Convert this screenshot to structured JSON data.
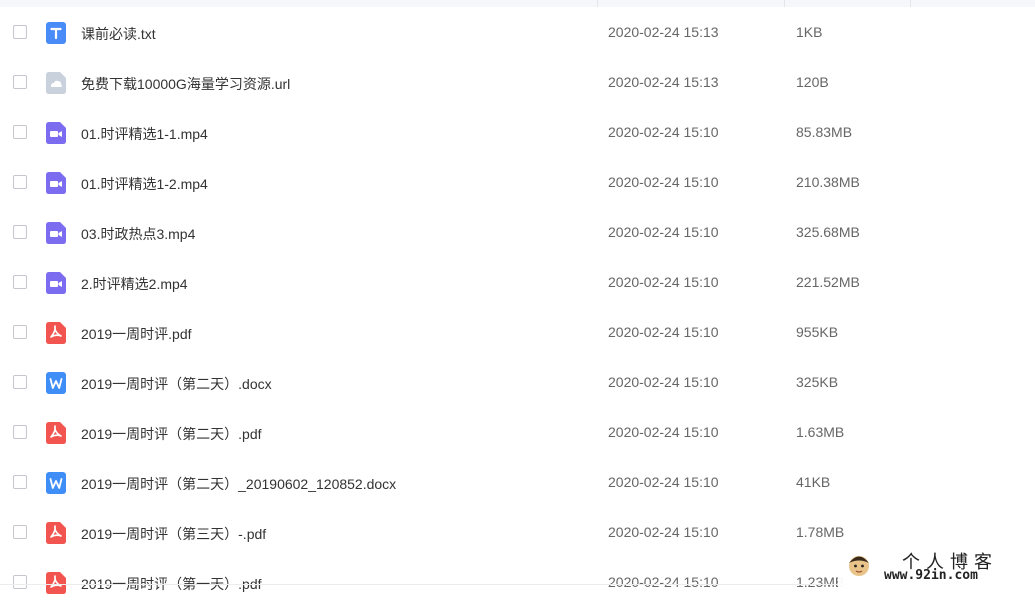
{
  "files": [
    {
      "name": "课前必读.txt",
      "date": "2020-02-24 15:13",
      "size": "1KB",
      "icon": "txt-file-icon"
    },
    {
      "name": "免费下载10000G海量学习资源.url",
      "date": "2020-02-24 15:13",
      "size": "120B",
      "icon": "url-file-icon"
    },
    {
      "name": "01.时评精选1-1.mp4",
      "date": "2020-02-24 15:10",
      "size": "85.83MB",
      "icon": "video-file-icon"
    },
    {
      "name": "01.时评精选1-2.mp4",
      "date": "2020-02-24 15:10",
      "size": "210.38MB",
      "icon": "video-file-icon"
    },
    {
      "name": "03.时政热点3.mp4",
      "date": "2020-02-24 15:10",
      "size": "325.68MB",
      "icon": "video-file-icon"
    },
    {
      "name": "2.时评精选2.mp4",
      "date": "2020-02-24 15:10",
      "size": "221.52MB",
      "icon": "video-file-icon"
    },
    {
      "name": "2019一周时评.pdf",
      "date": "2020-02-24 15:10",
      "size": "955KB",
      "icon": "pdf-file-icon"
    },
    {
      "name": "2019一周时评（第二天）.docx",
      "date": "2020-02-24 15:10",
      "size": "325KB",
      "icon": "word-file-icon"
    },
    {
      "name": "2019一周时评（第二天）.pdf",
      "date": "2020-02-24 15:10",
      "size": "1.63MB",
      "icon": "pdf-file-icon"
    },
    {
      "name": "2019一周时评（第二天）_20190602_120852.docx",
      "date": "2020-02-24 15:10",
      "size": "41KB",
      "icon": "word-file-icon"
    },
    {
      "name": "2019一周时评（第三天）-.pdf",
      "date": "2020-02-24 15:10",
      "size": "1.78MB",
      "icon": "pdf-file-icon"
    },
    {
      "name": "2019一周时评（第一天）.pdf",
      "date": "2020-02-24 15:10",
      "size": "1.23MB",
      "icon": "pdf-file-icon"
    }
  ],
  "watermark": {
    "title": "个人博客",
    "url": "www.92in.com"
  },
  "colors": {
    "txt": "#4a8cf7",
    "url": "#c8d1dc",
    "video": "#7b6cf0",
    "pdf": "#f2554f",
    "word": "#3f8ef7"
  }
}
